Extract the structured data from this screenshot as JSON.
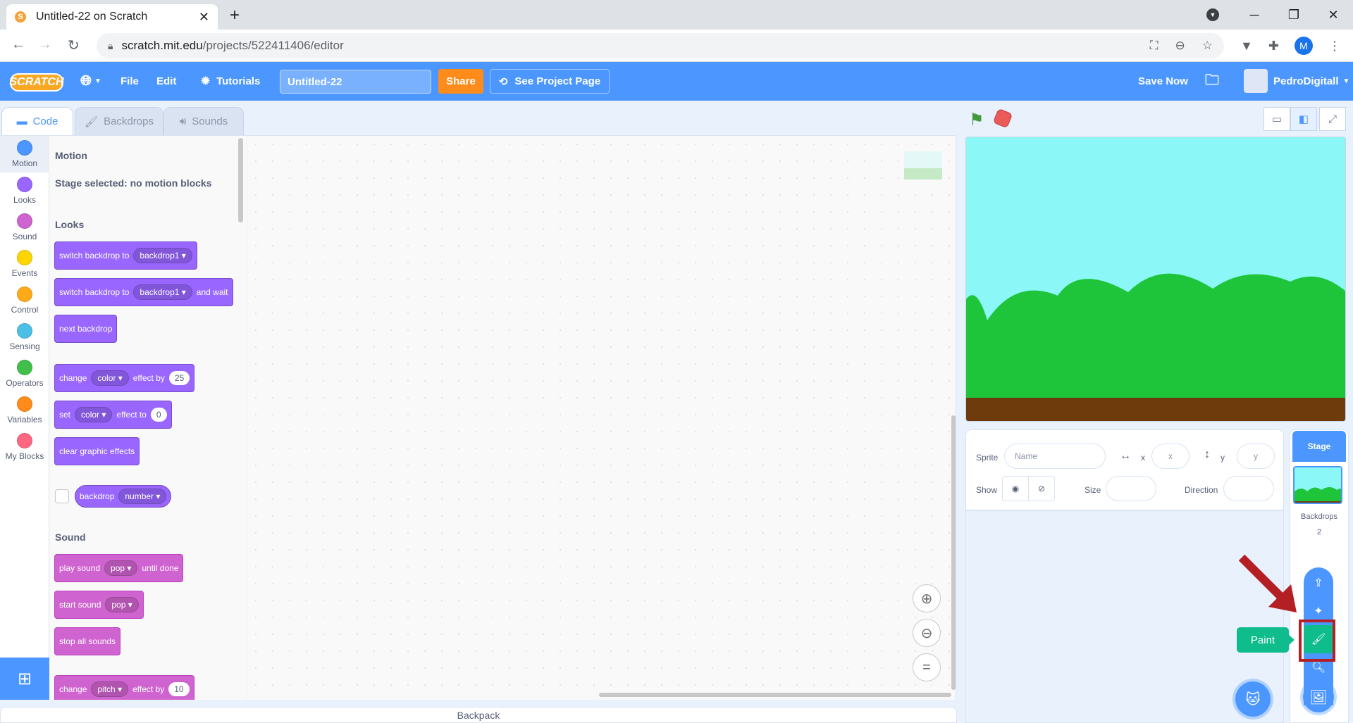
{
  "browser": {
    "tab_title": "Untitled-22 on Scratch",
    "url_host": "scratch.mit.edu",
    "url_path": "/projects/522411406/editor",
    "profile_initial": "M"
  },
  "menubar": {
    "logo": "SCRATCH",
    "file": "File",
    "edit": "Edit",
    "tutorials": "Tutorials",
    "project_title": "Untitled-22",
    "share": "Share",
    "see_project_page": "See Project Page",
    "save_now": "Save Now",
    "username": "PedroDigitall"
  },
  "editor_tabs": {
    "code": "Code",
    "backdrops": "Backdrops",
    "sounds": "Sounds"
  },
  "categories": [
    {
      "label": "Motion",
      "color": "#4c97ff"
    },
    {
      "label": "Looks",
      "color": "#9966ff"
    },
    {
      "label": "Sound",
      "color": "#cf63cf"
    },
    {
      "label": "Events",
      "color": "#ffd500"
    },
    {
      "label": "Control",
      "color": "#ffab19"
    },
    {
      "label": "Sensing",
      "color": "#4cbfe6"
    },
    {
      "label": "Operators",
      "color": "#40bf4a"
    },
    {
      "label": "Variables",
      "color": "#ff8c1a"
    },
    {
      "label": "My Blocks",
      "color": "#ff6680"
    }
  ],
  "palette": {
    "motion_heading": "Motion",
    "motion_note": "Stage selected: no motion blocks",
    "looks_heading": "Looks",
    "sound_heading": "Sound",
    "blocks": {
      "switch_backdrop": "switch backdrop to",
      "backdrop1": "backdrop1",
      "and_wait": "and wait",
      "next_backdrop": "next backdrop",
      "change": "change",
      "color": "color",
      "effect_by": "effect by",
      "effect_by_value": "25",
      "set": "set",
      "effect_to": "effect to",
      "effect_to_value": "0",
      "clear_graphic_effects": "clear graphic effects",
      "backdrop": "backdrop",
      "number": "number",
      "play_sound": "play sound",
      "pop": "pop",
      "until_done": "until done",
      "start_sound": "start sound",
      "stop_all_sounds": "stop all sounds",
      "pitch": "pitch",
      "pitch_value": "10"
    }
  },
  "backpack": "Backpack",
  "sprite_info": {
    "sprite_label": "Sprite",
    "name_placeholder": "Name",
    "x_label": "x",
    "x_placeholder": "x",
    "y_label": "y",
    "y_placeholder": "y",
    "show_label": "Show",
    "size_label": "Size",
    "direction_label": "Direction"
  },
  "stage_panel": {
    "stage_label": "Stage",
    "backdrops_label": "Backdrops",
    "backdrops_count": "2"
  },
  "tooltip": {
    "paint": "Paint"
  }
}
